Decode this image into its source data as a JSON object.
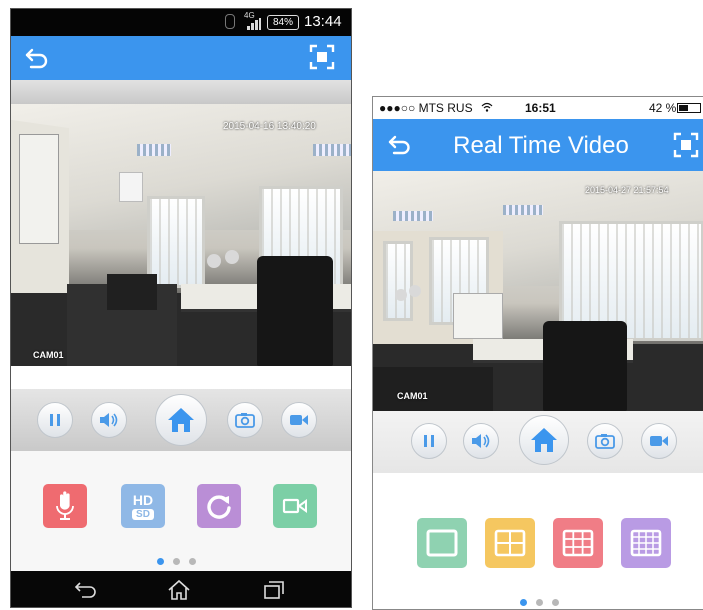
{
  "android": {
    "status": {
      "battery": "84%",
      "time": "13:44",
      "network": "4G"
    },
    "video": {
      "timestamp": "2015-04-16 13:40:20",
      "camera": "CAM01"
    },
    "feature_buttons": {
      "hd_top": "HD",
      "hd_bottom": "SD"
    },
    "colors": {
      "nav": "#3b95ee",
      "mic": "#ef6b70",
      "hd": "#8fb8e6",
      "rotate": "#ba8ed6",
      "record": "#7ccfa6"
    },
    "pager": {
      "pages": 3,
      "active": 1
    }
  },
  "ios": {
    "status": {
      "carrier": "●●●○○ MTS RUS",
      "time": "16:51",
      "battery": "42 %"
    },
    "nav": {
      "title": "Real Time Video"
    },
    "video": {
      "timestamp": "2015-04-27 21:57:54",
      "camera": "CAM01"
    },
    "colors": {
      "layout1": "#8fd2b1",
      "layout4": "#f5c760",
      "layout9": "#f07d86",
      "layout16": "#b99be4"
    },
    "pager": {
      "pages": 3,
      "active": 1
    }
  }
}
